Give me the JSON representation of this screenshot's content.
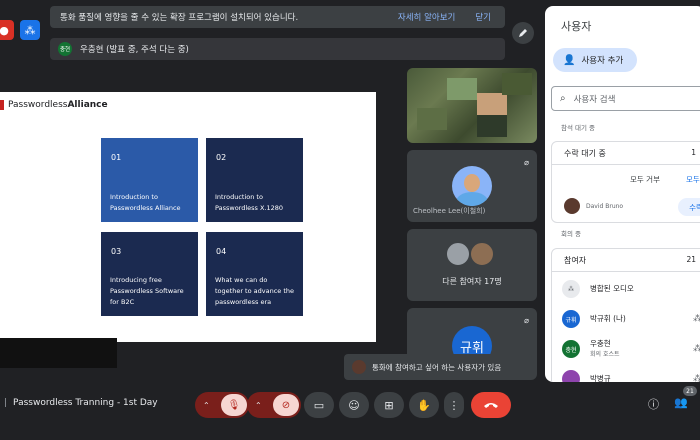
{
  "notice": {
    "message": "통화 품질에 영향을 줄 수 있는 확장 프로그램이 설치되어 있습니다.",
    "learn_more": "자세히 알아보기",
    "close": "닫기"
  },
  "presenter": {
    "chip": "충현",
    "label": "우충현 (발표 중, 주석 다는 중)"
  },
  "slide": {
    "logo_light": "Passwordless",
    "logo_bold": "Alliance",
    "tiles": [
      {
        "num": "01",
        "text": "Introduction to Passwordless Alliance"
      },
      {
        "num": "02",
        "text": "Introduction to Passwordless X.1280"
      },
      {
        "num": "03",
        "text": "Introducing free Passwordless Software for B2C"
      },
      {
        "num": "04",
        "text": "What we can do together to advance the passwordless era"
      }
    ]
  },
  "tiles": {
    "p2_name": "Cheolhee Lee(이철희)",
    "others_label": "다른 참여자 17명",
    "p4_avatar": "규휘"
  },
  "panel": {
    "title": "사용자",
    "add_people": "사용자 추가",
    "search_placeholder": "사용자 검색",
    "waiting_section": "참석 대기 중",
    "waiting_header": "수락 대기 중",
    "waiting_count": "1",
    "deny_all": "모두 거부",
    "admit_all": "모두",
    "guest_name": "David Bruno",
    "admit": "수락",
    "in_call_section": "회의 중",
    "participants_header": "참여자",
    "participants_count": "21",
    "merged_audio": "병합된 오디오",
    "people": [
      {
        "initials": "규휘",
        "name": "박규휘 (나)",
        "sub": ""
      },
      {
        "initials": "충현",
        "name": "우충현",
        "sub": "회의 호스트"
      },
      {
        "initials": "",
        "name": "박병규",
        "sub": ""
      }
    ]
  },
  "toast": {
    "message": "통화에 참여하고 싶어 하는 사용자가 있음"
  },
  "bottom": {
    "time": "",
    "meeting_title": "Passwordless Tranning - 1st Day",
    "people_badge": "21"
  }
}
